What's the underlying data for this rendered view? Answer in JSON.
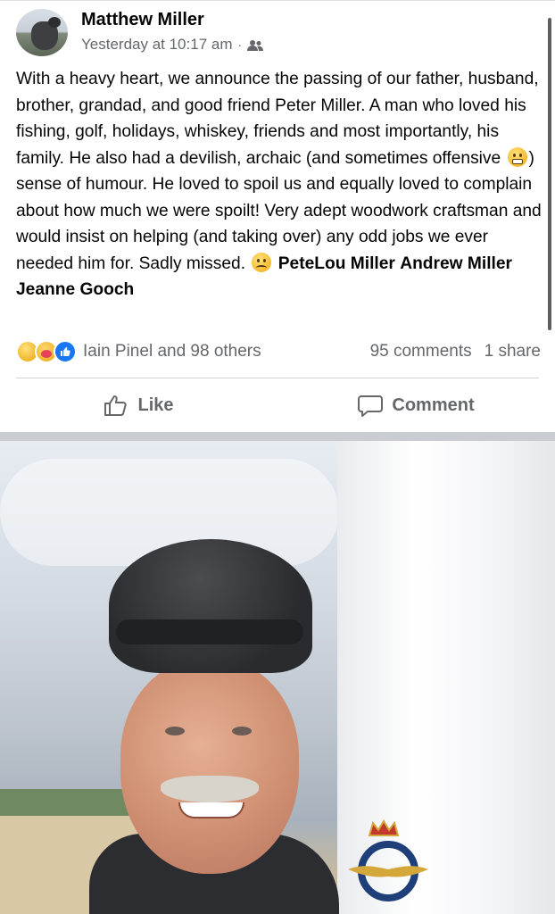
{
  "post": {
    "author": "Matthew Miller",
    "timestamp": "Yesterday at 10:17 am",
    "separator": "·",
    "audience_icon": "friends-icon",
    "text_parts": {
      "part1": "With a heavy heart, we announce the passing of our father, husband, brother, grandad, and good friend Peter Miller. A man who loved his fishing, golf, holidays, whiskey, friends and most importantly, his family. He also had a devilish, archaic (and sometimes offensive",
      "part2": ") sense of humour. He loved to spoil us and equally loved to complain about how much we were spoilt! Very adept woodwork craftsman and would insist on helping (and taking over) any odd jobs we ever needed him for. Sadly missed.",
      "mention1": "PeteLou Miller",
      "mention2": "Andrew Miller",
      "mention3": "Jeanne Gooch"
    },
    "emojis": [
      "grimacing-emoji",
      "slightly-frowning-emoji"
    ]
  },
  "reactions": {
    "icons": [
      "sad-reaction-icon",
      "care-reaction-icon",
      "like-reaction-icon"
    ],
    "summary": "Iain Pinel and 98 others",
    "comments": "95 comments",
    "shares": "1 share"
  },
  "actions": {
    "like_label": "Like",
    "comment_label": "Comment"
  },
  "colors": {
    "text": "#050505",
    "secondary": "#65676b",
    "like_blue": "#1877f2",
    "divider": "#ced0d4"
  }
}
